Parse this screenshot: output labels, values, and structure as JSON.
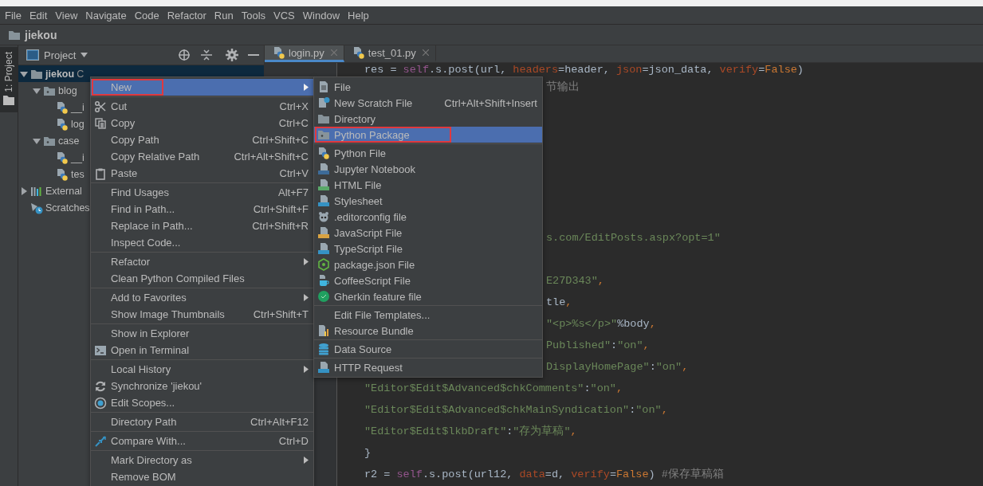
{
  "menu_bar": [
    "File",
    "Edit",
    "View",
    "Navigate",
    "Code",
    "Refactor",
    "Run",
    "Tools",
    "VCS",
    "Window",
    "Help"
  ],
  "nav_bar": {
    "project": "jiekou"
  },
  "tool_stripe": {
    "tab": "1: Project",
    "selected": true
  },
  "project_panel": {
    "title": "Project",
    "tree": [
      {
        "label": "jiekou",
        "path": "C",
        "kind": "folder",
        "expanded": true,
        "selected": true,
        "children": [
          {
            "label": "blog",
            "kind": "package",
            "expanded": true,
            "selected": false,
            "children": [
              {
                "label": "__i",
                "kind": "python",
                "selected": false
              },
              {
                "label": "log",
                "kind": "python",
                "selected": false
              }
            ]
          },
          {
            "label": "case",
            "kind": "package",
            "expanded": true,
            "selected": false,
            "children": [
              {
                "label": "__i",
                "kind": "python",
                "selected": false
              },
              {
                "label": "tes",
                "kind": "python",
                "selected": false
              }
            ]
          }
        ]
      },
      {
        "label": "External",
        "kind": "library",
        "expanded": false,
        "selected": false
      },
      {
        "label": "Scratches",
        "kind": "scratches",
        "selected": false
      }
    ]
  },
  "editor": {
    "tabs": [
      {
        "label": "login.py",
        "selected": true
      },
      {
        "label": "test_01.py",
        "selected": false
      }
    ],
    "lines": [
      {
        "kind": "full",
        "segments": [
          {
            "text": "res = ",
            "kind": "plain"
          },
          {
            "text": "self",
            "kind": "self"
          },
          {
            "text": ".s.post(url, ",
            "kind": "plain"
          },
          {
            "text": "headers",
            "kind": "param"
          },
          {
            "text": "=header, ",
            "kind": "plain"
          },
          {
            "text": "json",
            "kind": "param"
          },
          {
            "text": "=json_data, ",
            "kind": "plain"
          },
          {
            "text": "verify",
            "kind": "param"
          },
          {
            "text": "=",
            "kind": "plain"
          },
          {
            "text": "False",
            "kind": "keyword"
          },
          {
            "text": ")",
            "kind": "plain"
          }
        ]
      },
      {
        "kind": "clipped",
        "segments": [
          {
            "text": "节输出",
            "kind": "comment"
          }
        ]
      },
      {
        "kind": "hidden"
      },
      {
        "kind": "hidden"
      },
      {
        "kind": "hidden"
      },
      {
        "kind": "hidden"
      },
      {
        "kind": "hidden"
      },
      {
        "kind": "hidden"
      },
      {
        "kind": "clipped",
        "segments": [
          {
            "text": "s.com/EditPosts.aspx?opt=1\"",
            "kind": "string"
          }
        ]
      },
      {
        "kind": "hidden"
      },
      {
        "kind": "clipped",
        "segments": [
          {
            "text": "E27D343\"",
            "kind": "string"
          },
          {
            "text": ",",
            "kind": "keyword"
          }
        ]
      },
      {
        "kind": "clipped",
        "segments": [
          {
            "text": "tle",
            "kind": "plain"
          },
          {
            "text": ",",
            "kind": "keyword"
          }
        ]
      },
      {
        "kind": "clipped",
        "segments": [
          {
            "text": "\"<p>%s</p>\"",
            "kind": "string"
          },
          {
            "text": "%body",
            "kind": "plain"
          },
          {
            "text": ",",
            "kind": "keyword"
          }
        ]
      },
      {
        "kind": "clipped",
        "segments": [
          {
            "text": "Published\"",
            "kind": "string"
          },
          {
            "text": ":",
            "kind": "plain"
          },
          {
            "text": "\"on\"",
            "kind": "string"
          },
          {
            "text": ",",
            "kind": "keyword"
          }
        ]
      },
      {
        "kind": "clipped",
        "segments": [
          {
            "text": "DisplayHomePage\"",
            "kind": "string"
          },
          {
            "text": ":",
            "kind": "plain"
          },
          {
            "text": "\"on\"",
            "kind": "string"
          },
          {
            "text": ",",
            "kind": "keyword"
          }
        ]
      },
      {
        "kind": "full",
        "segments": [
          {
            "text": "\"Editor$Edit$Advanced$chkComments\"",
            "kind": "string"
          },
          {
            "text": ":",
            "kind": "plain"
          },
          {
            "text": "\"on\"",
            "kind": "string"
          },
          {
            "text": ",",
            "kind": "keyword"
          }
        ]
      },
      {
        "kind": "full",
        "segments": [
          {
            "text": "\"Editor$Edit$Advanced$chkMainSyndication\"",
            "kind": "string"
          },
          {
            "text": ":",
            "kind": "plain"
          },
          {
            "text": "\"on\"",
            "kind": "string"
          },
          {
            "text": ",",
            "kind": "keyword"
          }
        ]
      },
      {
        "kind": "full",
        "segments": [
          {
            "text": "\"Editor$Edit$lkbDraft\"",
            "kind": "string"
          },
          {
            "text": ":",
            "kind": "plain"
          },
          {
            "text": "\"存为草稿\"",
            "kind": "string"
          },
          {
            "text": ",",
            "kind": "keyword"
          }
        ]
      },
      {
        "kind": "full",
        "segments": [
          {
            "text": "}",
            "kind": "plain"
          }
        ]
      },
      {
        "kind": "full",
        "segments": [
          {
            "text": "r2 = ",
            "kind": "plain"
          },
          {
            "text": "self",
            "kind": "self"
          },
          {
            "text": ".s.post(url12, ",
            "kind": "plain"
          },
          {
            "text": "data",
            "kind": "param"
          },
          {
            "text": "=d, ",
            "kind": "plain"
          },
          {
            "text": "verify",
            "kind": "param"
          },
          {
            "text": "=",
            "kind": "plain"
          },
          {
            "text": "False",
            "kind": "keyword"
          },
          {
            "text": ") ",
            "kind": "plain"
          },
          {
            "text": "#保存草稿箱",
            "kind": "comment"
          }
        ]
      }
    ]
  },
  "context_menu": {
    "groups": [
      {
        "items": [
          {
            "label": "New",
            "arrow": true,
            "selected": true,
            "annotated": true
          }
        ]
      },
      {
        "items": [
          {
            "label": "Cut",
            "kind": "scissors",
            "shortcut": "Ctrl+X",
            "selected": false
          },
          {
            "label": "Copy",
            "kind": "copy",
            "shortcut": "Ctrl+C",
            "selected": false
          },
          {
            "label": "Copy Path",
            "shortcut": "Ctrl+Shift+C",
            "selected": false
          },
          {
            "label": "Copy Relative Path",
            "shortcut": "Ctrl+Alt+Shift+C",
            "selected": false
          },
          {
            "label": "Paste",
            "kind": "paste",
            "shortcut": "Ctrl+V",
            "selected": false
          }
        ]
      },
      {
        "items": [
          {
            "label": "Find Usages",
            "shortcut": "Alt+F7",
            "selected": false
          },
          {
            "label": "Find in Path...",
            "shortcut": "Ctrl+Shift+F",
            "selected": false
          },
          {
            "label": "Replace in Path...",
            "shortcut": "Ctrl+Shift+R",
            "selected": false
          },
          {
            "label": "Inspect Code...",
            "selected": false
          }
        ]
      },
      {
        "items": [
          {
            "label": "Refactor",
            "arrow": true,
            "selected": false
          },
          {
            "label": "Clean Python Compiled Files",
            "selected": false
          }
        ]
      },
      {
        "items": [
          {
            "label": "Add to Favorites",
            "arrow": true,
            "selected": false
          },
          {
            "label": "Show Image Thumbnails",
            "shortcut": "Ctrl+Shift+T",
            "selected": false
          }
        ]
      },
      {
        "items": [
          {
            "label": "Show in Explorer",
            "selected": false
          },
          {
            "label": "Open in Terminal",
            "kind": "terminal",
            "selected": false
          }
        ]
      },
      {
        "items": [
          {
            "label": "Local History",
            "arrow": true,
            "selected": false
          },
          {
            "label": "Synchronize 'jiekou'",
            "kind": "sync",
            "selected": false
          },
          {
            "label": "Edit Scopes...",
            "kind": "scope",
            "selected": false
          }
        ]
      },
      {
        "items": [
          {
            "label": "Directory Path",
            "shortcut": "Ctrl+Alt+F12",
            "selected": false
          }
        ]
      },
      {
        "items": [
          {
            "label": "Compare With...",
            "kind": "compare",
            "shortcut": "Ctrl+D",
            "selected": false
          }
        ]
      },
      {
        "items": [
          {
            "label": "Mark Directory as",
            "arrow": true,
            "selected": false
          },
          {
            "label": "Remove BOM",
            "selected": false
          }
        ]
      }
    ]
  },
  "submenu": {
    "groups": [
      {
        "items": [
          {
            "label": "File",
            "kind": "file",
            "selected": false
          },
          {
            "label": "New Scratch File",
            "kind": "scratch",
            "shortcut": "Ctrl+Alt+Shift+Insert",
            "selected": false
          },
          {
            "label": "Directory",
            "kind": "folder",
            "selected": false
          },
          {
            "label": "Python Package",
            "kind": "package",
            "selected": true,
            "annotated": true
          }
        ]
      },
      {
        "items": [
          {
            "label": "Python File",
            "kind": "python",
            "selected": false
          },
          {
            "label": "Jupyter Notebook",
            "kind": "jupyter",
            "selected": false
          },
          {
            "label": "HTML File",
            "kind": "html",
            "selected": false
          },
          {
            "label": "Stylesheet",
            "kind": "css",
            "selected": false
          },
          {
            "label": ".editorconfig file",
            "kind": "editorconfig",
            "selected": false
          },
          {
            "label": "JavaScript File",
            "kind": "js",
            "selected": false
          },
          {
            "label": "TypeScript File",
            "kind": "ts",
            "selected": false
          },
          {
            "label": "package.json File",
            "kind": "npm",
            "selected": false
          },
          {
            "label": "CoffeeScript File",
            "kind": "coffee",
            "selected": false
          },
          {
            "label": "Gherkin feature file",
            "kind": "gherkin",
            "selected": false
          }
        ]
      },
      {
        "items": [
          {
            "label": "Edit File Templates...",
            "selected": false
          },
          {
            "label": "Resource Bundle",
            "kind": "bundle",
            "selected": false
          }
        ]
      },
      {
        "items": [
          {
            "label": "Data Source",
            "kind": "database",
            "selected": false
          }
        ]
      },
      {
        "items": [
          {
            "label": "HTTP Request",
            "kind": "api",
            "selected": false
          }
        ]
      }
    ]
  }
}
